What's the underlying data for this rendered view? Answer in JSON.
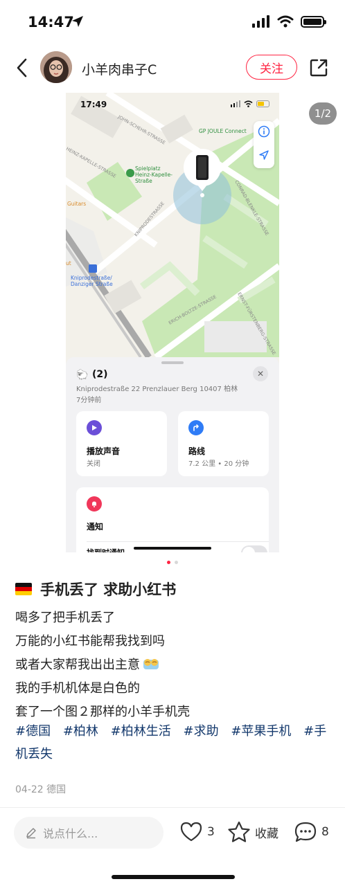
{
  "status_bar": {
    "time": "14:47"
  },
  "header": {
    "username": "小羊肉串子C",
    "follow_label": "关注"
  },
  "carousel": {
    "page_indicator": "1/2",
    "screenshot": {
      "time": "17:49",
      "map_labels": {
        "street1": "JOHN-SCHEHR-STRASSE",
        "poi_gp": "GP JOULE Connect",
        "street2": "HEINZ-KAPELLE-STRASSE",
        "poi_playground_1": "Spielplatz",
        "poi_playground_2": "Heinz-Kapelle-",
        "poi_playground_3": "Straße",
        "poi_guitars": "Guitars",
        "poi_ut": "ut",
        "street3": "KNIPRODESTRASSE",
        "street4": "CONRAD-BLENKLE-STRASSE",
        "station_1": "Kniprodestraße/",
        "station_2": "Danziger Straße",
        "street5": "ERICH-BOLTZE-STRASSE",
        "street6": "ERNST-FÜRSTENBERG-STRASSE"
      },
      "device": {
        "name": "(2)",
        "address": "Kniprodestraße 22 Prenzlauer Berg 10407 柏林",
        "updated": "7分钟前"
      },
      "play_sound": {
        "title": "播放声音",
        "sub": "关闭"
      },
      "directions": {
        "title": "路线",
        "sub": "7.2 公里 • 20 分钟"
      },
      "notify": {
        "title": "通知",
        "row": "找到时通知"
      }
    }
  },
  "post": {
    "title": "手机丢了 求助小红书",
    "body": [
      "喝多了把手机丢了",
      "万能的小红书能帮我找到吗",
      "或者大家帮我出出主意",
      "我的手机机体是白色的",
      "套了一个图２那样的小羊手机壳"
    ],
    "tags": [
      "#德国",
      "#柏林",
      "#柏林生活",
      "#求助",
      "#苹果手机",
      "#手机丢失"
    ],
    "meta": "04-22 德国"
  },
  "bottom_bar": {
    "comment_placeholder": "说点什么...",
    "like_count": "3",
    "favorite_label": "收藏",
    "comment_count": "8"
  },
  "colors": {
    "accent": "#ff2442",
    "tag": "#13386c",
    "map_park": "#c9e8b5",
    "map_location": "#8ec0d8"
  },
  "icons": [
    "location-arrow-icon",
    "signal-icon",
    "wifi-icon",
    "battery-icon",
    "back-icon",
    "share-icon",
    "info-icon",
    "lamb-icon",
    "close-icon",
    "play-icon",
    "directions-icon",
    "bell-icon",
    "germany-flag-icon",
    "pencil-icon",
    "heart-icon",
    "star-icon",
    "comment-icon"
  ]
}
